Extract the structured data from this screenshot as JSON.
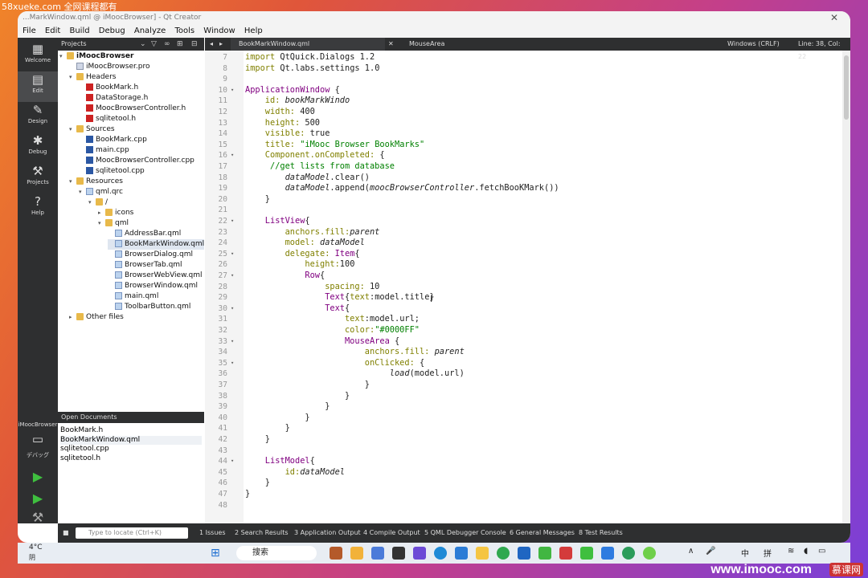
{
  "watermark_top": "58xueke.com 全网课程都有",
  "watermark_bottom": "www.imooc.com",
  "watermark_logo": "慕课网",
  "titlebar": "...MarkWindow.qml @ iMoocBrowser] - Qt Creator",
  "menu": [
    "File",
    "Edit",
    "Build",
    "Debug",
    "Analyze",
    "Tools",
    "Window",
    "Help"
  ],
  "modes": [
    {
      "label": "Welcome",
      "icon": "▦"
    },
    {
      "label": "Edit",
      "icon": "▤"
    },
    {
      "label": "Design",
      "icon": "✎"
    },
    {
      "label": "Debug",
      "icon": "✱"
    },
    {
      "label": "Projects",
      "icon": "⚒"
    },
    {
      "label": "Help",
      "icon": "?"
    }
  ],
  "target_label": "iMoocBrowser",
  "target_sub": "デバッグ",
  "projects_label": "Projects",
  "tree": [
    {
      "text": "iMoocBrowser",
      "indent": 0,
      "arrow": "▾",
      "icon": "folder",
      "bold": true
    },
    {
      "text": "iMoocBrowser.pro",
      "indent": 1,
      "arrow": "",
      "icon": "pro"
    },
    {
      "text": "Headers",
      "indent": 1,
      "arrow": "▾",
      "icon": "folder"
    },
    {
      "text": "BookMark.h",
      "indent": 2,
      "arrow": "",
      "icon": "h"
    },
    {
      "text": "DataStorage.h",
      "indent": 2,
      "arrow": "",
      "icon": "h"
    },
    {
      "text": "MoocBrowserController.h",
      "indent": 2,
      "arrow": "",
      "icon": "h"
    },
    {
      "text": "sqlitetool.h",
      "indent": 2,
      "arrow": "",
      "icon": "h"
    },
    {
      "text": "Sources",
      "indent": 1,
      "arrow": "▾",
      "icon": "folder"
    },
    {
      "text": "BookMark.cpp",
      "indent": 2,
      "arrow": "",
      "icon": "cpp"
    },
    {
      "text": "main.cpp",
      "indent": 2,
      "arrow": "",
      "icon": "cpp"
    },
    {
      "text": "MoocBrowserController.cpp",
      "indent": 2,
      "arrow": "",
      "icon": "cpp"
    },
    {
      "text": "sqlitetool.cpp",
      "indent": 2,
      "arrow": "",
      "icon": "cpp"
    },
    {
      "text": "Resources",
      "indent": 1,
      "arrow": "▾",
      "icon": "folder"
    },
    {
      "text": "qml.qrc",
      "indent": 2,
      "arrow": "▾",
      "icon": "qml"
    },
    {
      "text": "/",
      "indent": 3,
      "arrow": "▾",
      "icon": "folder"
    },
    {
      "text": "icons",
      "indent": 4,
      "arrow": "▸",
      "icon": "folder"
    },
    {
      "text": "qml",
      "indent": 4,
      "arrow": "▾",
      "icon": "folder"
    },
    {
      "text": "AddressBar.qml",
      "indent": 5,
      "arrow": "",
      "icon": "qml"
    },
    {
      "text": "BookMarkWindow.qml",
      "indent": 5,
      "arrow": "",
      "icon": "qml",
      "selected": true
    },
    {
      "text": "BrowserDialog.qml",
      "indent": 5,
      "arrow": "",
      "icon": "qml"
    },
    {
      "text": "BrowserTab.qml",
      "indent": 5,
      "arrow": "",
      "icon": "qml"
    },
    {
      "text": "BrowserWebView.qml",
      "indent": 5,
      "arrow": "",
      "icon": "qml"
    },
    {
      "text": "BrowserWindow.qml",
      "indent": 5,
      "arrow": "",
      "icon": "qml"
    },
    {
      "text": "main.qml",
      "indent": 5,
      "arrow": "",
      "icon": "qml"
    },
    {
      "text": "ToolbarButton.qml",
      "indent": 5,
      "arrow": "",
      "icon": "qml"
    },
    {
      "text": "Other files",
      "indent": 1,
      "arrow": "▸",
      "icon": "folder"
    }
  ],
  "open_docs_label": "Open Documents",
  "open_docs": [
    "BookMark.h",
    "BookMarkWindow.qml",
    "sqlitetool.cpp",
    "sqlitetool.h"
  ],
  "editor": {
    "file_tab": "BookMarkWindow.qml",
    "symbol": "MouseArea",
    "line_ending": "Windows (CRLF)",
    "position": "Line: 38, Col: 22"
  },
  "code": [
    {
      "n": "7",
      "f": "",
      "s": [
        {
          "t": "import ",
          "c": "kw"
        },
        {
          "t": "QtQuick.Dialogs 1.2",
          "c": ""
        }
      ]
    },
    {
      "n": "8",
      "f": "",
      "s": [
        {
          "t": "import ",
          "c": "kw"
        },
        {
          "t": "Qt.labs.settings 1.0",
          "c": ""
        }
      ]
    },
    {
      "n": "9",
      "f": "",
      "s": []
    },
    {
      "n": "10",
      "f": "▾",
      "s": [
        {
          "t": "ApplicationWindow ",
          "c": "tp"
        },
        {
          "t": "{",
          "c": ""
        }
      ]
    },
    {
      "n": "11",
      "f": "",
      "s": [
        {
          "t": "    id: ",
          "c": "kw"
        },
        {
          "t": "bookMarkWindo",
          "c": "it"
        }
      ]
    },
    {
      "n": "12",
      "f": "",
      "s": [
        {
          "t": "    width: ",
          "c": "kw"
        },
        {
          "t": "400",
          "c": ""
        }
      ]
    },
    {
      "n": "13",
      "f": "",
      "s": [
        {
          "t": "    height: ",
          "c": "kw"
        },
        {
          "t": "500",
          "c": ""
        }
      ]
    },
    {
      "n": "14",
      "f": "",
      "s": [
        {
          "t": "    visible: ",
          "c": "kw"
        },
        {
          "t": "true",
          "c": ""
        }
      ]
    },
    {
      "n": "15",
      "f": "",
      "s": [
        {
          "t": "    title: ",
          "c": "kw"
        },
        {
          "t": "\"iMooc Browser BookMarks\"",
          "c": "str"
        }
      ]
    },
    {
      "n": "16",
      "f": "▾",
      "s": [
        {
          "t": "    Component.onCompleted: ",
          "c": "kw"
        },
        {
          "t": "{",
          "c": ""
        }
      ]
    },
    {
      "n": "17",
      "f": "",
      "s": [
        {
          "t": "     //get lists from database",
          "c": "cm"
        }
      ]
    },
    {
      "n": "18",
      "f": "",
      "s": [
        {
          "t": "        ",
          "c": ""
        },
        {
          "t": "dataModel",
          "c": "it"
        },
        {
          "t": ".clear()",
          "c": ""
        }
      ]
    },
    {
      "n": "19",
      "f": "",
      "s": [
        {
          "t": "        ",
          "c": ""
        },
        {
          "t": "dataModel",
          "c": "it"
        },
        {
          "t": ".append(",
          "c": ""
        },
        {
          "t": "moocBrowserController",
          "c": "it"
        },
        {
          "t": ".fetchBooKMark())",
          "c": ""
        }
      ]
    },
    {
      "n": "20",
      "f": "",
      "s": [
        {
          "t": "    }",
          "c": ""
        }
      ]
    },
    {
      "n": "21",
      "f": "",
      "s": []
    },
    {
      "n": "22",
      "f": "▾",
      "s": [
        {
          "t": "    ListView",
          "c": "tp"
        },
        {
          "t": "{",
          "c": ""
        }
      ]
    },
    {
      "n": "23",
      "f": "",
      "s": [
        {
          "t": "        anchors.fill:",
          "c": "kw"
        },
        {
          "t": "parent",
          "c": "it"
        }
      ]
    },
    {
      "n": "24",
      "f": "",
      "s": [
        {
          "t": "        model: ",
          "c": "kw"
        },
        {
          "t": "dataModel",
          "c": "it"
        }
      ]
    },
    {
      "n": "25",
      "f": "▾",
      "s": [
        {
          "t": "        delegate: ",
          "c": "kw"
        },
        {
          "t": "Item",
          "c": "tp"
        },
        {
          "t": "{",
          "c": ""
        }
      ]
    },
    {
      "n": "26",
      "f": "",
      "s": [
        {
          "t": "            height:",
          "c": "kw"
        },
        {
          "t": "100",
          "c": ""
        }
      ]
    },
    {
      "n": "27",
      "f": "▾",
      "s": [
        {
          "t": "            Row",
          "c": "tp"
        },
        {
          "t": "{",
          "c": ""
        }
      ]
    },
    {
      "n": "28",
      "f": "",
      "s": [
        {
          "t": "                spacing: ",
          "c": "kw"
        },
        {
          "t": "10",
          "c": ""
        }
      ]
    },
    {
      "n": "29",
      "f": "",
      "s": [
        {
          "t": "                Text",
          "c": "tp"
        },
        {
          "t": "{",
          "c": ""
        },
        {
          "t": "text",
          "c": "kw"
        },
        {
          "t": ":model.title}",
          "c": ""
        }
      ]
    },
    {
      "n": "30",
      "f": "▾",
      "s": [
        {
          "t": "                Text",
          "c": "tp"
        },
        {
          "t": "{",
          "c": ""
        }
      ]
    },
    {
      "n": "31",
      "f": "",
      "s": [
        {
          "t": "                    text",
          "c": "kw"
        },
        {
          "t": ":model.url;",
          "c": ""
        }
      ]
    },
    {
      "n": "32",
      "f": "",
      "s": [
        {
          "t": "                    color:",
          "c": "kw"
        },
        {
          "t": "\"#0000FF\"",
          "c": "str"
        }
      ]
    },
    {
      "n": "33",
      "f": "▾",
      "s": [
        {
          "t": "                    MouseArea ",
          "c": "tp"
        },
        {
          "t": "{",
          "c": ""
        }
      ]
    },
    {
      "n": "34",
      "f": "",
      "s": [
        {
          "t": "                        anchors.fill: ",
          "c": "kw"
        },
        {
          "t": "parent",
          "c": "it"
        }
      ]
    },
    {
      "n": "35",
      "f": "▾",
      "s": [
        {
          "t": "                        onClicked: ",
          "c": "kw"
        },
        {
          "t": "{",
          "c": ""
        }
      ]
    },
    {
      "n": "36",
      "f": "",
      "s": [
        {
          "t": "                             ",
          "c": ""
        },
        {
          "t": "load",
          "c": "it"
        },
        {
          "t": "(model.url)",
          "c": ""
        }
      ]
    },
    {
      "n": "37",
      "f": "",
      "s": [
        {
          "t": "                        }",
          "c": ""
        }
      ]
    },
    {
      "n": "38",
      "f": "",
      "s": [
        {
          "t": "                    }",
          "c": ""
        }
      ]
    },
    {
      "n": "39",
      "f": "",
      "s": [
        {
          "t": "                }",
          "c": ""
        }
      ]
    },
    {
      "n": "40",
      "f": "",
      "s": [
        {
          "t": "            }",
          "c": ""
        }
      ]
    },
    {
      "n": "41",
      "f": "",
      "s": [
        {
          "t": "        }",
          "c": ""
        }
      ]
    },
    {
      "n": "42",
      "f": "",
      "s": [
        {
          "t": "    }",
          "c": ""
        }
      ]
    },
    {
      "n": "43",
      "f": "",
      "s": []
    },
    {
      "n": "44",
      "f": "▾",
      "s": [
        {
          "t": "    ListModel",
          "c": "tp"
        },
        {
          "t": "{",
          "c": ""
        }
      ]
    },
    {
      "n": "45",
      "f": "",
      "s": [
        {
          "t": "        id:",
          "c": "kw"
        },
        {
          "t": "dataModel",
          "c": "it"
        }
      ]
    },
    {
      "n": "46",
      "f": "",
      "s": [
        {
          "t": "    }",
          "c": ""
        }
      ]
    },
    {
      "n": "47",
      "f": "",
      "s": [
        {
          "t": "}",
          "c": ""
        }
      ]
    },
    {
      "n": "48",
      "f": "",
      "s": []
    }
  ],
  "status": {
    "locator_placeholder": "Type to locate (Ctrl+K)",
    "panes": [
      "1 Issues",
      "2 Search Results",
      "3 Application Output",
      "4 Compile Output",
      "5 QML Debugger Console",
      "6 General Messages",
      "8 Test Results"
    ]
  },
  "taskbar": {
    "weather_temp": "4°C",
    "weather_desc": "阴",
    "search": "搜索",
    "tray": [
      "∧",
      "🎤",
      "中",
      "拼"
    ]
  }
}
